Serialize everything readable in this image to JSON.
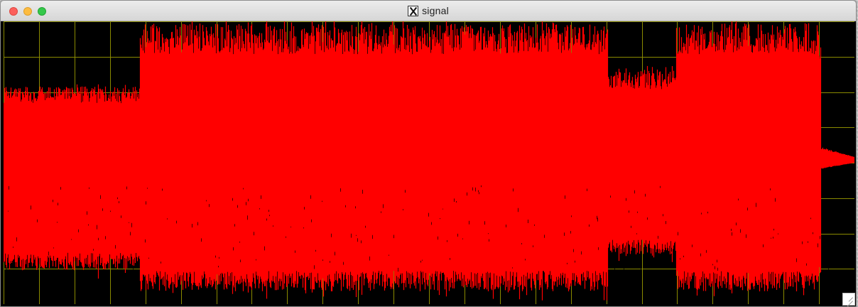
{
  "window": {
    "title": "signal",
    "icons": {
      "close": "close-button",
      "minimize": "minimize-button",
      "zoom": "zoom-button",
      "app": "x11-icon",
      "resize": "resize-grip-icon"
    }
  },
  "colors": {
    "signal": "#ff0000",
    "background": "#000000",
    "grid": "#8a8a00"
  },
  "chart_data": {
    "type": "area",
    "title": "",
    "xlabel": "",
    "ylabel": "",
    "grid": true,
    "legend": "none",
    "ylim": [
      -1,
      1
    ],
    "segments": [
      {
        "start": 0.0,
        "end": 0.16,
        "pos": 0.5,
        "neg": -0.78
      },
      {
        "start": 0.16,
        "end": 0.41,
        "pos": 0.93,
        "neg": -0.93
      },
      {
        "start": 0.41,
        "end": 0.71,
        "pos": 0.93,
        "neg": -0.93
      },
      {
        "start": 0.71,
        "end": 0.79,
        "pos": 0.62,
        "neg": -0.67
      },
      {
        "start": 0.79,
        "end": 0.96,
        "pos": 0.93,
        "neg": -0.93
      },
      {
        "start": 0.96,
        "end": 1.0,
        "pos": 0.08,
        "neg": -0.05
      }
    ]
  }
}
